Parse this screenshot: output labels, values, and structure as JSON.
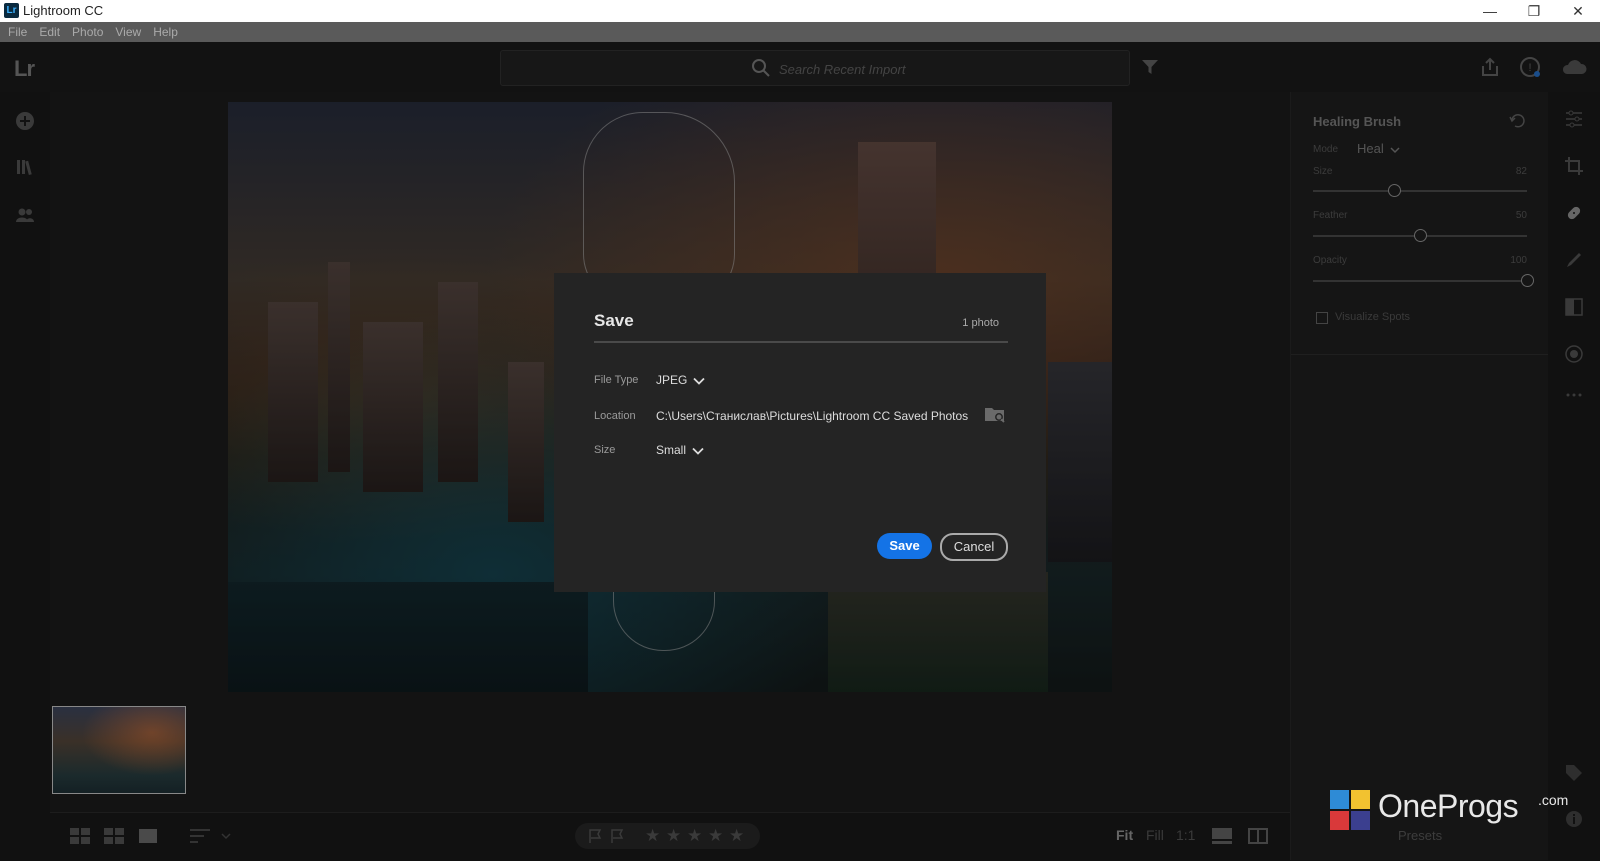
{
  "window": {
    "title": "Lightroom CC",
    "logo": "Lr",
    "controls": [
      "—",
      "❐",
      "✕"
    ]
  },
  "menu": [
    "File",
    "Edit",
    "Photo",
    "View",
    "Help"
  ],
  "topbar": {
    "brand": "Lr",
    "search_placeholder": "Search Recent Import"
  },
  "healing_panel": {
    "title": "Healing Brush",
    "mode_label": "Mode",
    "mode_value": "Heal",
    "size_label": "Size",
    "size_value": "82",
    "feather_label": "Feather",
    "feather_value": "50",
    "opacity_label": "Opacity",
    "opacity_value": "100",
    "visualize_label": "Visualize Spots",
    "size_fraction": 0.38,
    "feather_fraction": 0.5,
    "opacity_fraction": 1.0
  },
  "dialog": {
    "title": "Save",
    "count": "1 photo",
    "file_type_label": "File Type",
    "file_type_value": "JPEG",
    "location_label": "Location",
    "location_value": "C:\\Users\\Станислав\\Pictures\\Lightroom CC Saved Photos",
    "size_label": "Size",
    "size_value": "Small",
    "save_button": "Save",
    "cancel_button": "Cancel"
  },
  "bottombar": {
    "zoom_fit": "Fit",
    "zoom_fill": "Fill",
    "zoom_1to1": "1:1",
    "presets": "Presets"
  },
  "watermark": {
    "text": "OneProgs",
    "suffix": ".com"
  },
  "colors": {
    "accent": "#1473e6",
    "dialog_bg": "#242424"
  },
  "icons": {
    "left_rail": [
      "add-photos-icon",
      "library-icon",
      "people-icon"
    ],
    "right_rail": [
      "edit-sliders-icon",
      "crop-icon",
      "healing-brush-icon",
      "brush-icon",
      "linear-gradient-icon",
      "radial-gradient-icon",
      "more-icon",
      "tag-icon",
      "info-icon"
    ]
  }
}
